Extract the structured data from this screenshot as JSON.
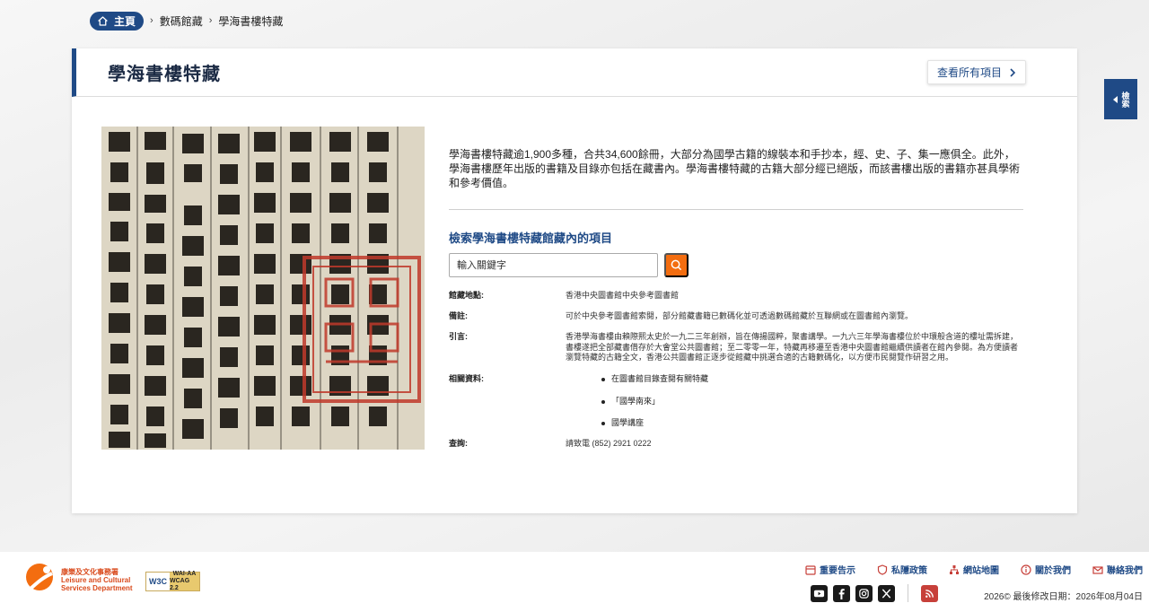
{
  "breadcrumb": {
    "home": "主頁",
    "level1": "數碼館藏",
    "current": "學海書樓特藏"
  },
  "card": {
    "title": "學海書樓特藏",
    "view_all": "查看所有項目"
  },
  "intro": "學海書樓特藏逾1,900多種，合共34,600餘冊，大部分為國學古籍的線裝本和手抄本，經、史、子、集一應俱全。此外，學海書樓歷年出版的書籍及目錄亦包括在藏書內。學海書樓特藏的古籍大部分經已絕版，而該書樓出版的書籍亦甚具學術和參考價值。",
  "search": {
    "title": "檢索學海書樓特藏館藏內的項目",
    "placeholder": "輸入關鍵字"
  },
  "info": {
    "location_label": "館藏地點:",
    "location_value": "香港中央圖書館中央參考圖書館",
    "remarks_label": "備註:",
    "remarks_value": "可於中央參考圖書館索閱，部分館藏書籍已數碼化並可透過數碼館藏於互聯網或在圖書館內瀏覽。",
    "intro_label": "引言:",
    "intro_value": "香港學海書樓由賴際熙太史於一九二三年創辦，旨在傳揚國粹，聚書講學。一九六三年學海書樓位於中環般含道的樓址需拆建，書樓遂把全部藏書借存於大會堂公共圖書館；至二零零一年，特藏再移遷至香港中央圖書館繼續供讀者在館內參閱。為方便讀者瀏覽特藏的古籍全文，香港公共圖書館正逐步從館藏中挑選合適的古籍數碼化，以方便市民閱覽作研習之用。",
    "related_label": "相關資料:",
    "related_items": [
      "在圖書館目錄查閱有關特藏",
      "「國學南來」",
      "國學講座"
    ],
    "enquiry_label": "查詢:",
    "enquiry_value": "請致電 (852) 2921 0222"
  },
  "side_tab": "檢索",
  "footer": {
    "lcsd_zh": "康樂及文化事務署",
    "lcsd_en1": "Leisure and Cultural",
    "lcsd_en2": "Services Department",
    "w3c": "W3C",
    "wcag1": "WAI-AA",
    "wcag2": "WCAG 2.2",
    "links": [
      "重要告示",
      "私隱政策",
      "網站地圖",
      "關於我們",
      "聯絡我們"
    ],
    "copyright": "2026©  最後修改日期：2026年08月04日"
  },
  "colors": {
    "brand": "#1f4a86",
    "accent": "#f36d10"
  }
}
